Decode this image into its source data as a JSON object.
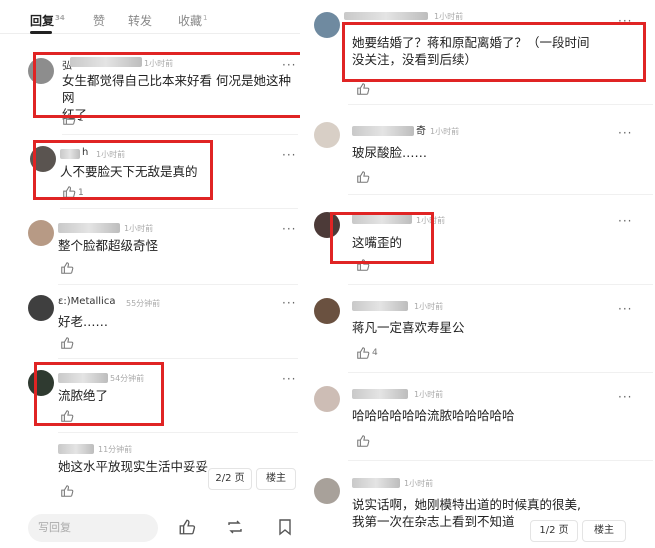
{
  "tabs": [
    {
      "label": "回复",
      "count": "34"
    },
    {
      "label": "赞"
    },
    {
      "label": "转发"
    },
    {
      "label": "收藏",
      "count": "1"
    }
  ],
  "left_comments": [
    {
      "user": "弘",
      "time": "1小时前",
      "text": [
        "女生都觉得自己比本来好看 何况是她这种网",
        "红了"
      ],
      "likes": "1"
    },
    {
      "user": "h",
      "time": "1小时前",
      "text": [
        "人不要脸天下无敌是真的"
      ],
      "likes": "1"
    },
    {
      "user": "",
      "time": "1小时前",
      "text": [
        "整个脸都超级奇怪"
      ],
      "likes": ""
    },
    {
      "user": "ε:)Metallica",
      "time": "55分钟前",
      "text": [
        "好老……"
      ],
      "likes": ""
    },
    {
      "user": "",
      "time": "54分钟前",
      "text": [
        "流脓绝了"
      ],
      "likes": ""
    },
    {
      "user": "",
      "time": "11分钟前",
      "text": [
        "她这水平放现实生活中妥妥的"
      ],
      "likes": ""
    }
  ],
  "left_pager": {
    "page": "2/2 页",
    "owner": "楼主"
  },
  "bottom_bar": {
    "reply_placeholder": "写回复"
  },
  "right_comments": [
    {
      "user": "",
      "time": "1小时前",
      "text": [
        "她要结婚了？蒋和原配离婚了？（一段时间",
        "没关注，没看到后续）"
      ],
      "likes": ""
    },
    {
      "user": "奇",
      "time": "1小时前",
      "text": [
        "玻尿酸脸……"
      ],
      "likes": ""
    },
    {
      "user": "",
      "time": "1小时前",
      "text": [
        "这嘴歪的"
      ],
      "likes": ""
    },
    {
      "user": "",
      "time": "1小时前",
      "text": [
        "蒋凡一定喜欢寿星公"
      ],
      "likes": "4"
    },
    {
      "user": "",
      "time": "1小时前",
      "text": [
        "哈哈哈哈哈哈流脓哈哈哈哈哈"
      ],
      "likes": ""
    },
    {
      "user": "",
      "time": "1小时前",
      "text": [
        "说实话啊，她刚模特出道的时候真的很美,",
        "我第一次在杂志上看到不知道"
      ],
      "likes": ""
    }
  ],
  "right_pager": {
    "page": "1/2 页",
    "owner": "楼主"
  },
  "colors": {
    "highlight": "#e02424",
    "text": "#222222",
    "meta": "#aaaaaa"
  },
  "icons": [
    "thumbs-up-icon",
    "more-dots-icon",
    "repost-icon",
    "bookmark-icon"
  ]
}
